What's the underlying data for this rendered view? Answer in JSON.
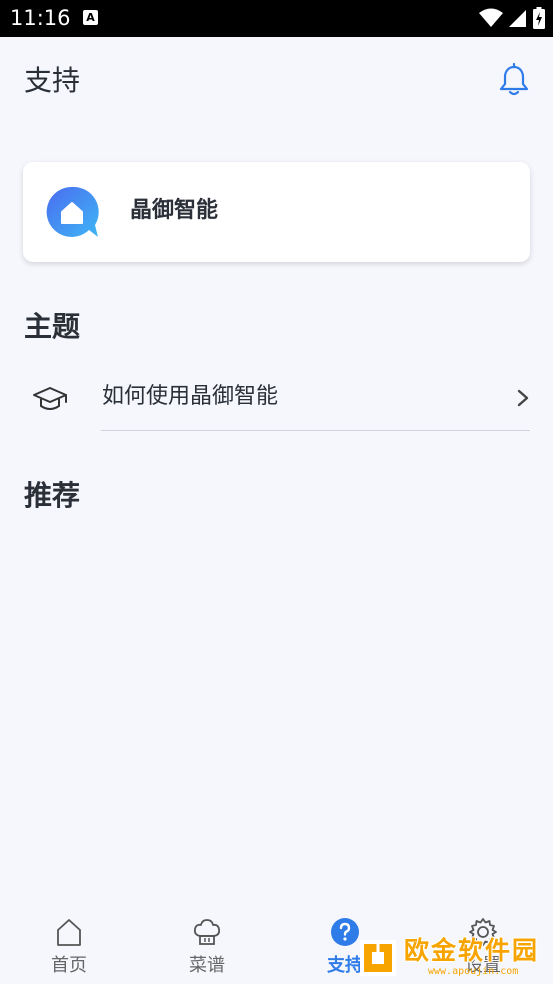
{
  "status_bar": {
    "time": "11:16",
    "notification_icon_letter": "A",
    "icons": [
      "wifi-icon",
      "signal-icon",
      "battery-icon"
    ]
  },
  "header": {
    "title": "支持",
    "bell_icon": "bell-icon"
  },
  "brand_card": {
    "name": "晶御智能",
    "logo_icon": "brand-logo-icon"
  },
  "sections": {
    "topics_title": "主题",
    "recommend_title": "推荐"
  },
  "topics": [
    {
      "label": "如何使用晶御智能",
      "icon": "graduation-cap-icon"
    }
  ],
  "tabbar": {
    "tabs": [
      {
        "label": "首页",
        "icon": "home-icon",
        "active": false
      },
      {
        "label": "菜谱",
        "icon": "chef-hat-icon",
        "active": false
      },
      {
        "label": "支持",
        "icon": "help-circle-icon",
        "active": true
      },
      {
        "label": "设置",
        "icon": "gear-icon",
        "active": false
      }
    ]
  },
  "watermark": {
    "text": "欧金软件园",
    "sub": "www.apoujin.com"
  },
  "colors": {
    "accent": "#2f7be8",
    "background": "#f5f7fd",
    "watermark": "#f7a400"
  }
}
